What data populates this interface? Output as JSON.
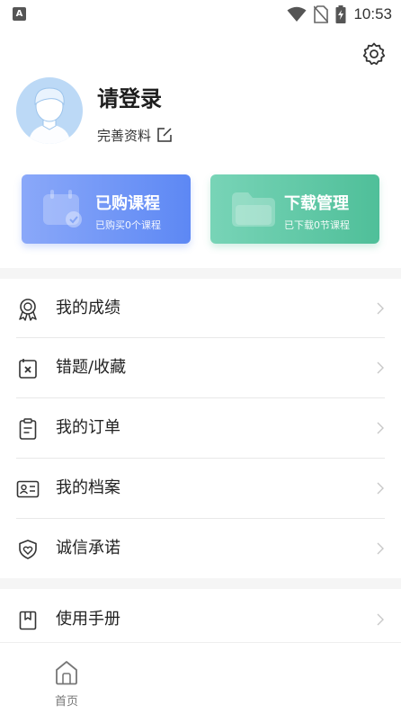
{
  "status_bar": {
    "time": "10:53",
    "left_badge": "A"
  },
  "profile": {
    "title": "请登录",
    "complete_link": "完善资料"
  },
  "cards": [
    {
      "title": "已购课程",
      "subtitle": "已购买0个课程",
      "color": "#5d88f4"
    },
    {
      "title": "下载管理",
      "subtitle": "已下载0节课程",
      "color": "#4fbf99"
    }
  ],
  "menu": {
    "items": [
      {
        "label": "我的成绩",
        "icon": "medal-icon"
      },
      {
        "label": "错题/收藏",
        "icon": "error-book-icon"
      },
      {
        "label": "我的订单",
        "icon": "clipboard-icon"
      },
      {
        "label": "我的档案",
        "icon": "id-card-icon"
      },
      {
        "label": "诚信承诺",
        "icon": "shield-heart-icon"
      },
      {
        "label": "使用手册",
        "icon": "bookmark-icon"
      }
    ]
  },
  "bottom_nav": {
    "home_label": "首页"
  }
}
